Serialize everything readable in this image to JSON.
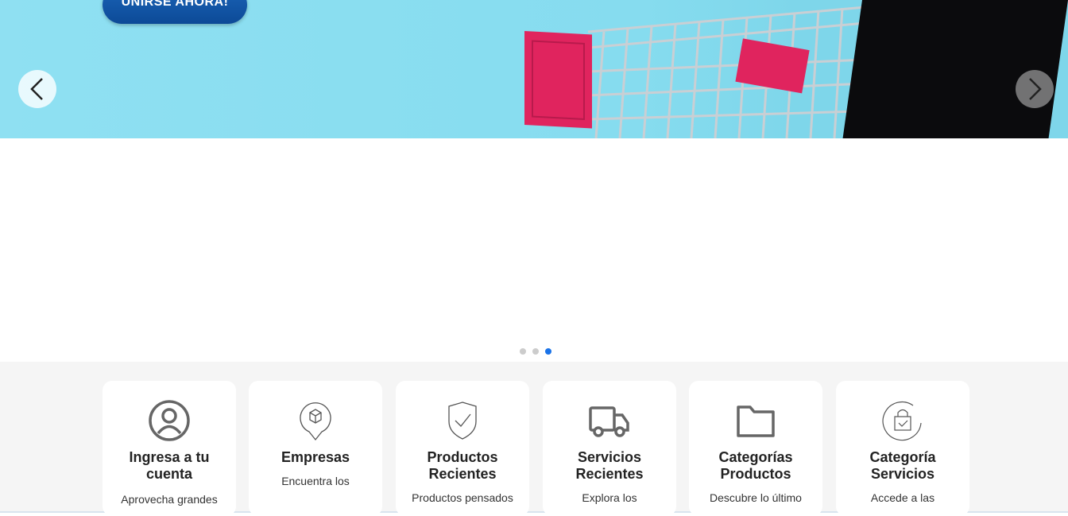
{
  "hero": {
    "join_label": "UNIRSE AHORA!",
    "prev_icon": "chevron-left-icon",
    "next_icon": "chevron-right-icon",
    "slides_total": 3,
    "active_slide": 3
  },
  "colors": {
    "hero_bg": "#8fe0f2",
    "button_blue": "#0c4a97",
    "dot_active": "#1a73e8",
    "dot_inactive": "#cccccc",
    "cart_red": "#e0245e"
  },
  "features": [
    {
      "icon": "user-circle-icon",
      "title": "Ingresa a tu cuenta",
      "desc": "Aprovecha grandes"
    },
    {
      "icon": "location-box-icon",
      "title": "Empresas",
      "desc": "Encuentra los"
    },
    {
      "icon": "shield-check-icon",
      "title": "Productos Recientes",
      "desc": "Productos pensados"
    },
    {
      "icon": "truck-icon",
      "title": "Servicios Recientes",
      "desc": "Explora los"
    },
    {
      "icon": "folder-icon",
      "title": "Categorías Productos",
      "desc": "Descubre lo último"
    },
    {
      "icon": "shopping-bag-icon",
      "title": "Categoría Servicios",
      "desc": "Accede a las"
    }
  ]
}
